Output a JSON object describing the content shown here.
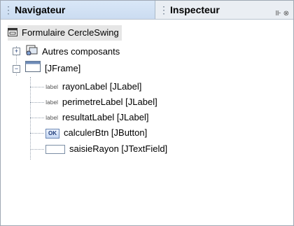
{
  "tabs": {
    "navigator": "Navigateur",
    "inspector": "Inspecteur",
    "icons": "⊪ ⊗"
  },
  "tree": {
    "root": "Formulaire CercleSwing",
    "other_components": "Autres composants",
    "frame": "[JFrame]",
    "children": [
      {
        "label": "rayonLabel [JLabel]",
        "icon": "label-icon"
      },
      {
        "label": "perimetreLabel [JLabel]",
        "icon": "label-icon"
      },
      {
        "label": "resultatLabel [JLabel]",
        "icon": "label-icon"
      },
      {
        "label": "calculerBtn [JButton]",
        "icon": "button-icon"
      },
      {
        "label": "saisieRayon [JTextField]",
        "icon": "textfield-icon"
      }
    ],
    "label_icon_text": "label",
    "button_icon_text": "OK"
  }
}
